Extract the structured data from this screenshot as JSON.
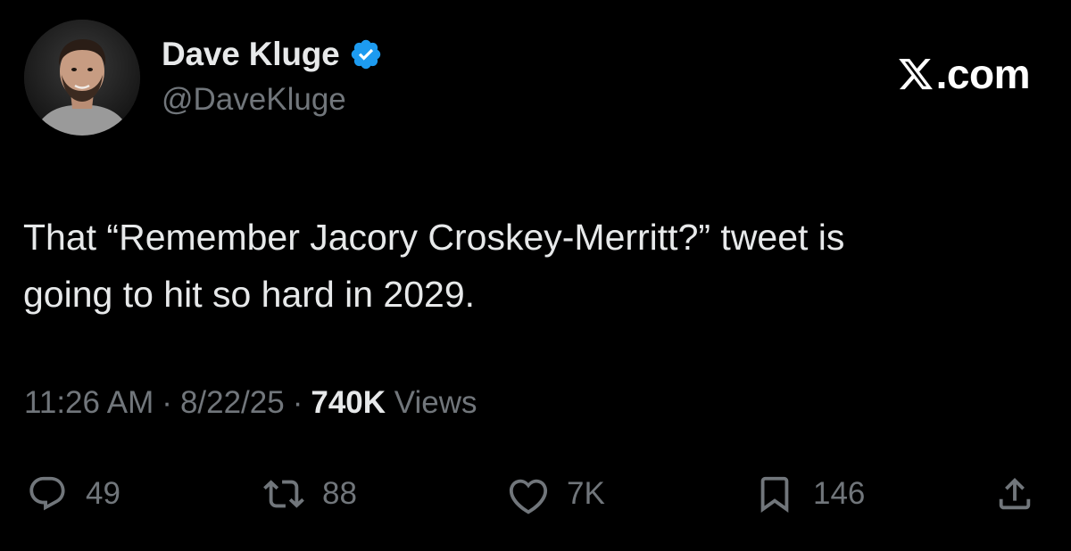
{
  "author": {
    "display_name": "Dave Kluge",
    "handle": "@DaveKluge",
    "verified": true,
    "verified_color": "#1d9bf0"
  },
  "watermark": {
    "text": ".com",
    "icon": "x-logo-icon"
  },
  "tweet": {
    "text": "That “Remember Jacory Croskey-Merritt?” tweet is\ngoing to hit so hard in 2029."
  },
  "meta": {
    "time": "11:26 AM",
    "date": "8/22/25",
    "separator": "·",
    "views_count": "740K",
    "views_label": "Views"
  },
  "actions": {
    "reply": {
      "icon": "reply-icon",
      "count": "49"
    },
    "repost": {
      "icon": "repost-icon",
      "count": "88"
    },
    "like": {
      "icon": "heart-icon",
      "count": "7K"
    },
    "bookmark": {
      "icon": "bookmark-icon",
      "count": "146"
    },
    "share": {
      "icon": "share-icon"
    }
  },
  "colors": {
    "background": "#000000",
    "primary_text": "#e7e9ea",
    "secondary_text": "#71767b",
    "accent": "#1d9bf0"
  }
}
